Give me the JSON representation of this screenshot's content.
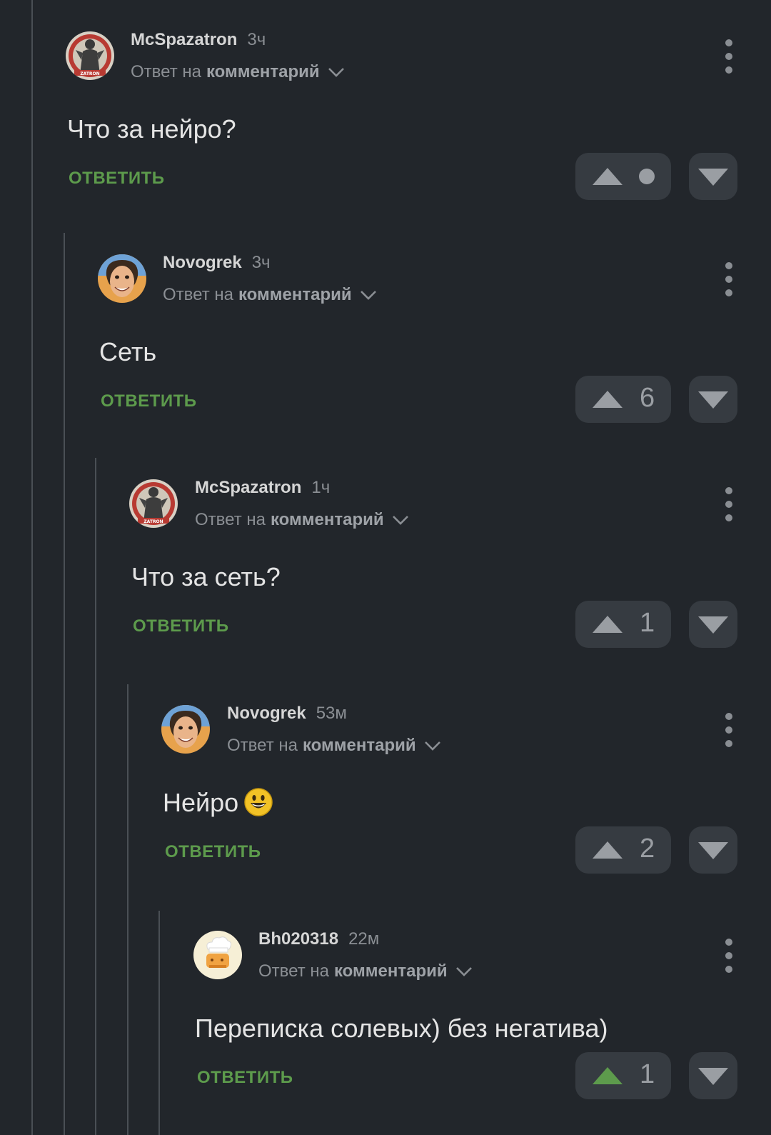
{
  "labels": {
    "reply_prefix": "Ответ на",
    "reply_link": "комментарий",
    "reply_button": "ОТВЕТИТЬ"
  },
  "colors": {
    "background": "#22262b",
    "username": "#d6d6d6",
    "muted": "#8b8f94",
    "reply_button": "#5d9b4c",
    "vote_bg": "#363b41",
    "upvoted": "#5d9b4c"
  },
  "comments": [
    {
      "username": "McSpazatron",
      "time": "3ч",
      "text": "Что за нейро?",
      "rating": "",
      "rating_hidden": true,
      "avatar": "poster-avatar",
      "upvoted": false
    },
    {
      "username": "Novogrek",
      "time": "3ч",
      "text": "Сеть",
      "rating": "6",
      "rating_hidden": false,
      "avatar": "face-avatar",
      "upvoted": false
    },
    {
      "username": "McSpazatron",
      "time": "1ч",
      "text": "Что за сеть?",
      "rating": "1",
      "rating_hidden": false,
      "avatar": "poster-avatar",
      "upvoted": false
    },
    {
      "username": "Novogrek",
      "time": "53м",
      "text": "Нейро",
      "text_emoji": "smiley-emoji",
      "rating": "2",
      "rating_hidden": false,
      "avatar": "face-avatar",
      "upvoted": false
    },
    {
      "username": "Bh020318",
      "time": "22м",
      "text": "Переписка солевых) без негатива)",
      "rating": "1",
      "rating_hidden": false,
      "avatar": "chef-avatar",
      "upvoted": true
    }
  ]
}
